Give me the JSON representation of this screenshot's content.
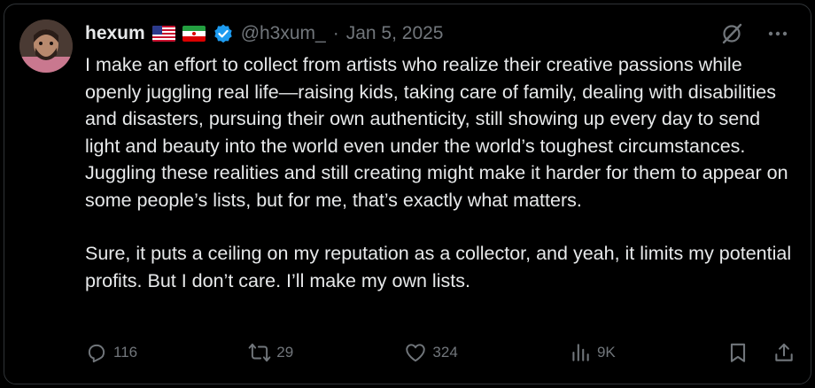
{
  "author": {
    "name": "hexum",
    "handle": "@h3xum_",
    "separator": "·",
    "date": "Jan 5, 2025",
    "avatar_icon": "person-avatar",
    "flags": [
      "us-flag-icon",
      "iran-flag-icon"
    ],
    "verified_color": "#1d9bf0"
  },
  "tweet": {
    "paragraph1": "I make an effort to collect from artists who realize their creative passions while openly juggling real life—raising kids, taking care of family, dealing with disabilities and disasters, pursuing their own authenticity, still showing up every day to send light and beauty into the world even under the world’s toughest circumstances. Juggling these realities and still creating might make it harder for them to appear on some people’s lists, but for me, that’s exactly what matters.",
    "paragraph2": "Sure, it puts a ceiling on my reputation as a collector, and yeah, it limits my potential profits. But I don’t care. I’ll make my own lists."
  },
  "actions": {
    "replies": "116",
    "reposts": "29",
    "likes": "324",
    "views": "9K"
  },
  "colors": {
    "background": "#000000",
    "text": "#e7e9ea",
    "muted": "#71767b"
  }
}
